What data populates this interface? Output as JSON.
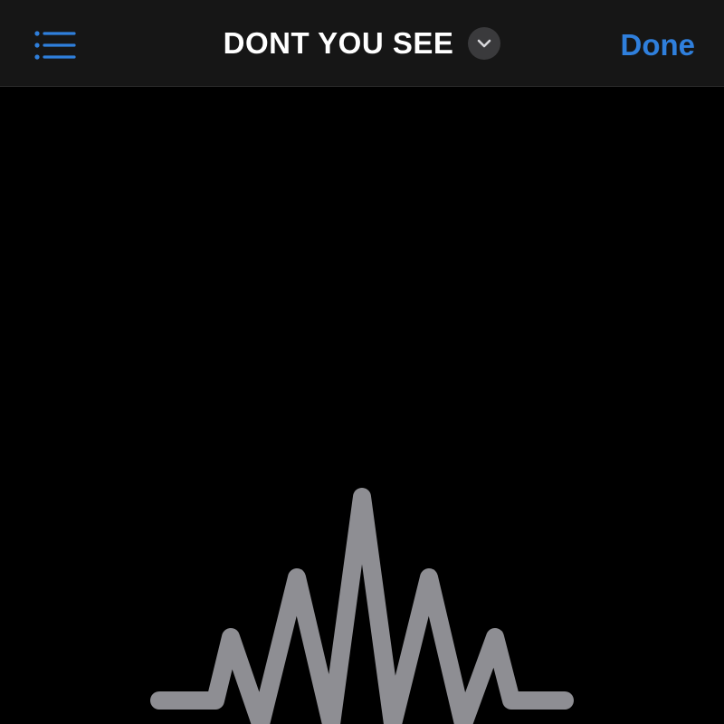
{
  "navbar": {
    "menu_icon": "list-icon",
    "title": "DONT YOU SEE",
    "title_chevron_icon": "chevron-down-icon",
    "done_label": "Done"
  },
  "canvas": {
    "glyph_icon": "waveform-icon"
  },
  "colors": {
    "accent": "#2f7fdc",
    "navbar_background": "#161616",
    "background": "#000000",
    "glyph": "#8e8e93",
    "chevron_background": "#3a3a3c"
  }
}
